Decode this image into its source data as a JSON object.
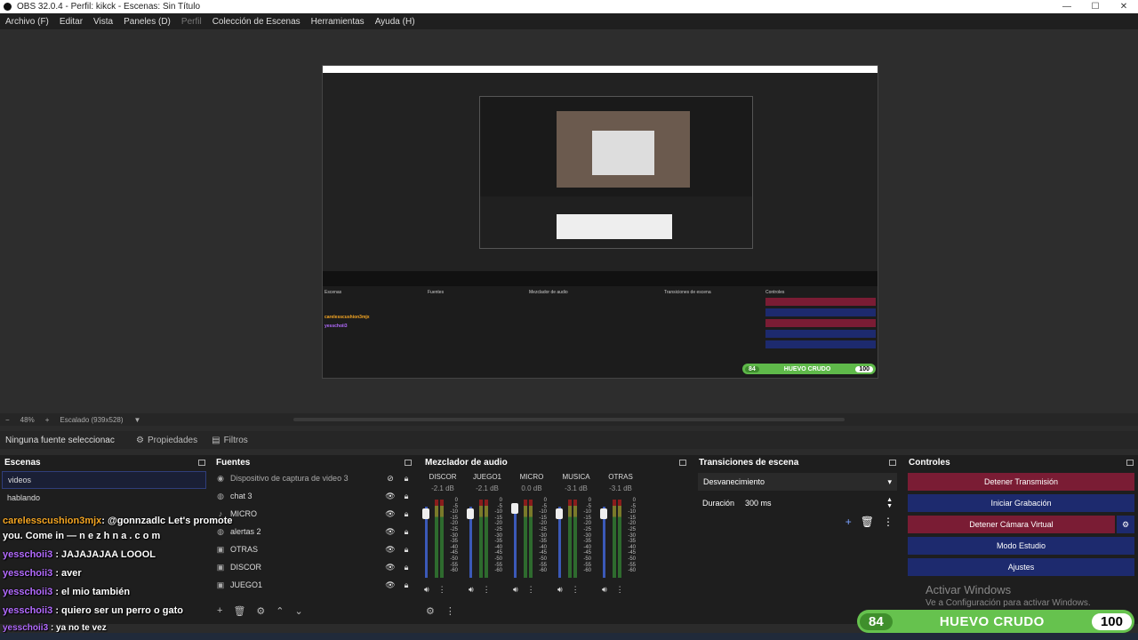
{
  "window": {
    "title": "OBS 32.0.4 - Perfil: kikck - Escenas: Sin Título",
    "min": "—",
    "max": "☐",
    "close": "✕"
  },
  "menu": [
    "Archivo (F)",
    "Editar",
    "Vista",
    "Paneles (D)",
    "Perfil",
    "Colección de Escenas",
    "Herramientas",
    "Ayuda (H)"
  ],
  "status": {
    "minus": "−",
    "zoom": "48%",
    "plus": "+",
    "scale": "Escalado (939x528)",
    "chevron": "▼"
  },
  "source_toolbar": {
    "no_source": "Ninguna fuente seleccionac",
    "properties": "Propiedades",
    "filters": "Filtros"
  },
  "docks": {
    "scenes": {
      "title": "Escenas",
      "items": [
        "videos",
        "hablando"
      ]
    },
    "sources": {
      "title": "Fuentes",
      "items": [
        {
          "label": "Dispositivo de captura de video 3",
          "icon": "camera-icon"
        },
        {
          "label": "chat 3",
          "icon": "globe-icon"
        },
        {
          "label": "MICRO",
          "icon": "mic-icon"
        },
        {
          "label": "alertas 2",
          "icon": "globe-icon"
        },
        {
          "label": "OTRAS",
          "icon": "window-icon"
        },
        {
          "label": "DISCOR",
          "icon": "window-icon"
        },
        {
          "label": "JUEGO1",
          "icon": "window-icon"
        }
      ]
    },
    "mixer": {
      "title": "Mezclador de audio",
      "channels": [
        {
          "name": "DISCOR",
          "db": "-2.1 dB"
        },
        {
          "name": "JUEGO1",
          "db": "-2.1 dB"
        },
        {
          "name": "MICRO",
          "db": "0.0 dB"
        },
        {
          "name": "MUSICA",
          "db": "-3.1 dB"
        },
        {
          "name": "OTRAS",
          "db": "-3.1 dB"
        }
      ],
      "scale": [
        "0",
        "-5",
        "-10",
        "-15",
        "-20",
        "-25",
        "-30",
        "-35",
        "-40",
        "-45",
        "-50",
        "-55",
        "-60"
      ]
    },
    "transitions": {
      "title": "Transiciones de escena",
      "selected": "Desvanecimiento",
      "duration_label": "Duración",
      "duration_value": "300 ms"
    },
    "controls": {
      "title": "Controles",
      "buttons": [
        "Detener Transmisión",
        "Iniciar Grabación",
        "Detener Cámara Virtual",
        "Modo Estudio",
        "Ajustes"
      ]
    }
  },
  "chat": [
    {
      "user": "carelesscushion3mjx",
      "msg": ": @gonnzadlc Let's promote"
    },
    {
      "user": "",
      "msg": "you. Come in — n e z h n a . c o m"
    },
    {
      "user": "yesschoii3",
      "msg": ": JAJAJAJAA LOOOL"
    },
    {
      "user": "yesschoii3",
      "msg": ": aver"
    },
    {
      "user": "yesschoii3",
      "msg": ": el mio también"
    },
    {
      "user": "yesschoii3",
      "msg": ": quiero ser un perro o gato"
    },
    {
      "user": "yesschoii3",
      "msg": ": ya no te vez"
    }
  ],
  "badge": {
    "left": "84",
    "text": "HUEVO CRUDO",
    "right": "100"
  },
  "watermark": {
    "title": "Activar Windows",
    "subtitle": "Ve a Configuración para activar Windows."
  },
  "colors": {
    "red_button": "#7a1c34",
    "blue_button": "#1d2a6e",
    "badge_green": "#66c24e"
  }
}
